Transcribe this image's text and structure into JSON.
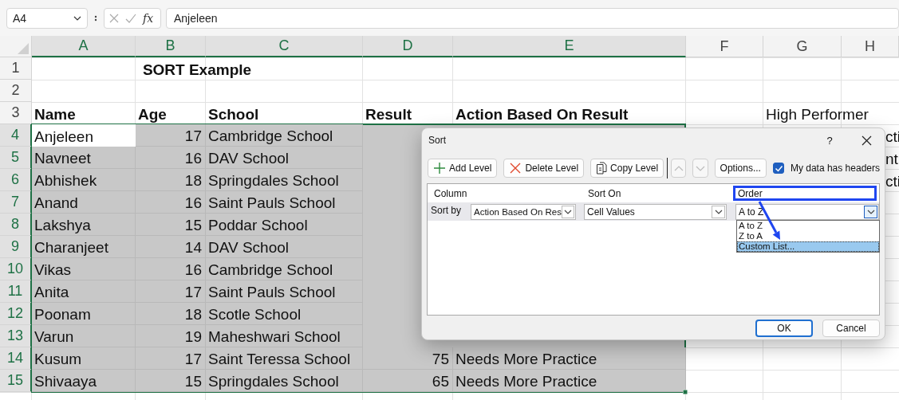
{
  "formula_bar": {
    "name_box": "A4",
    "function_label": "fx",
    "cell_value": "Anjeleen"
  },
  "sheet": {
    "columns": [
      {
        "label": "A",
        "selected": true
      },
      {
        "label": "B",
        "selected": true
      },
      {
        "label": "C",
        "selected": true
      },
      {
        "label": "D",
        "selected": true
      },
      {
        "label": "E",
        "selected": true
      },
      {
        "label": "F",
        "selected": false
      },
      {
        "label": "G",
        "selected": false
      },
      {
        "label": "H",
        "selected": false
      }
    ],
    "rows": [
      {
        "label": "1",
        "selected": false,
        "cells": {
          "A": {
            "kind": "title",
            "text": "SORT Example",
            "active": false
          }
        }
      },
      {
        "label": "2",
        "selected": false
      },
      {
        "label": "3",
        "selected": false,
        "cells": {
          "A": {
            "kind": "heading",
            "text": "Name",
            "active": false
          },
          "B": {
            "kind": "heading",
            "text": "Age",
            "active": false
          },
          "C": {
            "kind": "heading",
            "text": "School",
            "active": false
          },
          "D": {
            "kind": "heading",
            "text": "Result",
            "active": false
          },
          "E": {
            "kind": "heading",
            "text": "Action Based On Result",
            "active": false
          },
          "G": {
            "kind": "text",
            "text": "High Performer",
            "active": false
          }
        }
      },
      {
        "label": "4",
        "selected": true,
        "cells": {
          "A": {
            "kind": "text",
            "text": "Anjeleen",
            "active": true
          },
          "B": {
            "kind": "number",
            "text": "17",
            "active": false
          },
          "C": {
            "kind": "text",
            "text": "Cambridge School",
            "active": false
          },
          "H": {
            "kind": "fragment",
            "text": "cti",
            "active": false
          }
        }
      },
      {
        "label": "5",
        "selected": true,
        "cells": {
          "A": {
            "kind": "text",
            "text": "Navneet",
            "active": false
          },
          "B": {
            "kind": "number",
            "text": "16",
            "active": false
          },
          "C": {
            "kind": "text",
            "text": "DAV School",
            "active": false
          },
          "H": {
            "kind": "fragment",
            "text": "nt",
            "active": false
          }
        }
      },
      {
        "label": "6",
        "selected": true,
        "cells": {
          "A": {
            "kind": "text",
            "text": "Abhishek",
            "active": false
          },
          "B": {
            "kind": "number",
            "text": "18",
            "active": false
          },
          "C": {
            "kind": "text",
            "text": "Springdales School",
            "active": false
          },
          "H": {
            "kind": "fragment",
            "text": "cti",
            "active": false
          }
        }
      },
      {
        "label": "7",
        "selected": true,
        "cells": {
          "A": {
            "kind": "text",
            "text": "Anand",
            "active": false
          },
          "B": {
            "kind": "number",
            "text": "16",
            "active": false
          },
          "C": {
            "kind": "text",
            "text": "Saint Pauls School",
            "active": false
          }
        }
      },
      {
        "label": "8",
        "selected": true,
        "cells": {
          "A": {
            "kind": "text",
            "text": "Lakshya",
            "active": false
          },
          "B": {
            "kind": "number",
            "text": "15",
            "active": false
          },
          "C": {
            "kind": "text",
            "text": "Poddar School",
            "active": false
          }
        }
      },
      {
        "label": "9",
        "selected": true,
        "cells": {
          "A": {
            "kind": "text",
            "text": "Charanjeet",
            "active": false
          },
          "B": {
            "kind": "number",
            "text": "14",
            "active": false
          },
          "C": {
            "kind": "text",
            "text": "DAV School",
            "active": false
          }
        }
      },
      {
        "label": "10",
        "selected": true,
        "cells": {
          "A": {
            "kind": "text",
            "text": "Vikas",
            "active": false
          },
          "B": {
            "kind": "number",
            "text": "16",
            "active": false
          },
          "C": {
            "kind": "text",
            "text": "Cambridge School",
            "active": false
          }
        }
      },
      {
        "label": "11",
        "selected": true,
        "cells": {
          "A": {
            "kind": "text",
            "text": "Anita",
            "active": false
          },
          "B": {
            "kind": "number",
            "text": "17",
            "active": false
          },
          "C": {
            "kind": "text",
            "text": "Saint Pauls School",
            "active": false
          }
        }
      },
      {
        "label": "12",
        "selected": true,
        "cells": {
          "A": {
            "kind": "text",
            "text": "Poonam",
            "active": false
          },
          "B": {
            "kind": "number",
            "text": "18",
            "active": false
          },
          "C": {
            "kind": "text",
            "text": "Scotle School",
            "active": false
          }
        }
      },
      {
        "label": "13",
        "selected": true,
        "cells": {
          "A": {
            "kind": "text",
            "text": "Varun",
            "active": false
          },
          "B": {
            "kind": "number",
            "text": "19",
            "active": false
          },
          "C": {
            "kind": "text",
            "text": "Maheshwari School",
            "active": false
          }
        }
      },
      {
        "label": "14",
        "selected": true,
        "cells": {
          "A": {
            "kind": "text",
            "text": "Kusum",
            "active": false
          },
          "B": {
            "kind": "number",
            "text": "17",
            "active": false
          },
          "C": {
            "kind": "text",
            "text": "Saint Teressa School",
            "active": false
          },
          "D": {
            "kind": "number",
            "text": "75",
            "active": false
          },
          "E": {
            "kind": "text",
            "text": "Needs More Practice",
            "active": false
          }
        }
      },
      {
        "label": "15",
        "selected": true,
        "cells": {
          "A": {
            "kind": "text",
            "text": "Shivaaya",
            "active": false
          },
          "B": {
            "kind": "number",
            "text": "15",
            "active": false
          },
          "C": {
            "kind": "text",
            "text": "Springdales School",
            "active": false
          },
          "D": {
            "kind": "number",
            "text": "65",
            "active": false
          },
          "E": {
            "kind": "text",
            "text": "Needs More Practice",
            "active": false
          }
        }
      }
    ]
  },
  "sort_dialog": {
    "title": "Sort",
    "help": "?",
    "toolbar": [
      {
        "kind": "add",
        "label": "Add Level",
        "disabled": false
      },
      {
        "kind": "delete",
        "label": "Delete Level",
        "disabled": false
      },
      {
        "kind": "copy",
        "label": "Copy Level",
        "disabled": false
      },
      {
        "kind": "move_up",
        "disabled": true
      },
      {
        "kind": "move_down",
        "disabled": true
      },
      {
        "kind": "options",
        "label": "Options...",
        "disabled": false
      }
    ],
    "headers_checkbox": {
      "label": "My data has headers",
      "checked": true
    },
    "columns": [
      {
        "label": "Column",
        "highlighted": false
      },
      {
        "label": "Sort On",
        "highlighted": false
      },
      {
        "label": "Order",
        "highlighted": true
      }
    ],
    "levels": [
      {
        "label": "Sort by",
        "column": "Action Based On Res",
        "sort_on": "Cell Values",
        "order": "A to Z"
      }
    ],
    "order_dropdown": {
      "open": true,
      "options": [
        {
          "label": "A to Z",
          "selected": false
        },
        {
          "label": "Z to A",
          "selected": false
        },
        {
          "label": "Custom List...",
          "selected": true
        }
      ]
    },
    "buttons": [
      {
        "label": "OK",
        "default": true
      },
      {
        "label": "Cancel",
        "default": false
      }
    ]
  }
}
